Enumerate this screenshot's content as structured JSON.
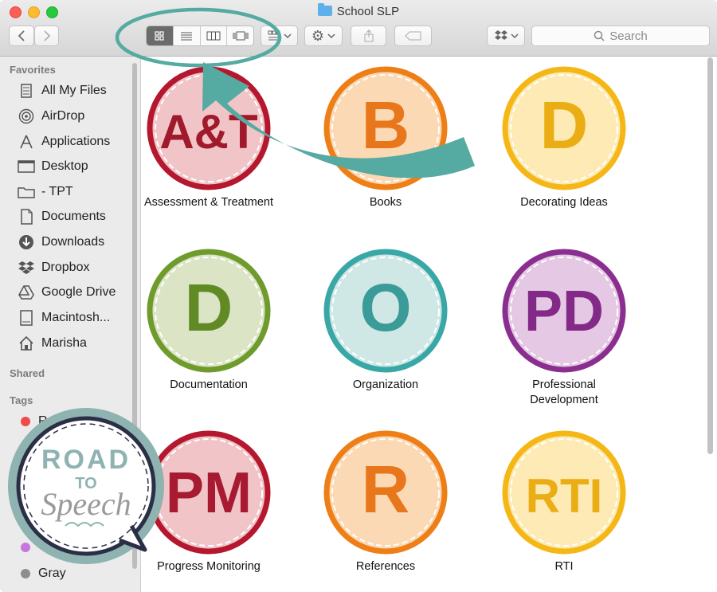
{
  "window": {
    "title": "School SLP"
  },
  "toolbar": {
    "back_icon": "chevron-left-icon",
    "forward_icon": "chevron-right-icon",
    "view_modes": [
      "icon-view",
      "list-view",
      "column-view",
      "cover-flow-view"
    ],
    "active_view": "icon-view",
    "search_placeholder": "Search"
  },
  "sidebar": {
    "favorites_header": "Favorites",
    "favorites": [
      {
        "label": "All My Files",
        "icon": "all-files-icon"
      },
      {
        "label": "AirDrop",
        "icon": "airdrop-icon"
      },
      {
        "label": "Applications",
        "icon": "applications-icon"
      },
      {
        "label": "Desktop",
        "icon": "desktop-icon"
      },
      {
        "label": "- TPT",
        "icon": "folder-icon"
      },
      {
        "label": "Documents",
        "icon": "documents-icon"
      },
      {
        "label": "Downloads",
        "icon": "downloads-icon"
      },
      {
        "label": "Dropbox",
        "icon": "dropbox-icon"
      },
      {
        "label": "Google Drive",
        "icon": "google-drive-icon"
      },
      {
        "label": "Macintosh...",
        "icon": "hard-drive-icon"
      },
      {
        "label": "Marisha",
        "icon": "home-icon"
      }
    ],
    "shared_header": "Shared",
    "tags_header": "Tags",
    "tags": [
      {
        "label": "R",
        "color": "#f04a4a"
      },
      {
        "label": "Gray",
        "color": "#8e8e8e"
      }
    ],
    "purple_tag_color": "#c875e0"
  },
  "folders": [
    {
      "label": "Assessment & Treatment",
      "letters": "A&T",
      "ring": "#b5172e",
      "fill": "#f1c5c8",
      "ink": "#a01a2c"
    },
    {
      "label": "Books",
      "letters": "B",
      "ring": "#ee7e16",
      "fill": "#fbd9b4",
      "ink": "#e8761a"
    },
    {
      "label": "Decorating Ideas",
      "letters": "D",
      "ring": "#f4b716",
      "fill": "#fdeab4",
      "ink": "#eaae14"
    },
    {
      "label": "Documentation",
      "letters": "D",
      "ring": "#6f9b2c",
      "fill": "#dbe5c6",
      "ink": "#5f8a24"
    },
    {
      "label": "Organization",
      "letters": "O",
      "ring": "#3aa7a7",
      "fill": "#cfe8e6",
      "ink": "#3b9b98"
    },
    {
      "label": "Professional Development",
      "letters": "PD",
      "ring": "#8a2e8f",
      "fill": "#e5c8e4",
      "ink": "#832a88"
    },
    {
      "label": "Progress Monitoring",
      "letters": "PM",
      "ring": "#b5172e",
      "fill": "#f1c5c8",
      "ink": "#a71a31"
    },
    {
      "label": "References",
      "letters": "R",
      "ring": "#ee7e16",
      "fill": "#fbd9b4",
      "ink": "#e8761a"
    },
    {
      "label": "RTI",
      "letters": "RTI",
      "ring": "#f4b716",
      "fill": "#fdeab4",
      "ink": "#eaae14"
    }
  ],
  "badge": {
    "line1": "ROAD",
    "line2": "TO",
    "line3": "Speech",
    "ring_color": "#8fb3b0",
    "border_color": "#2b2f46"
  },
  "annotation": {
    "color": "#55aaa1"
  }
}
